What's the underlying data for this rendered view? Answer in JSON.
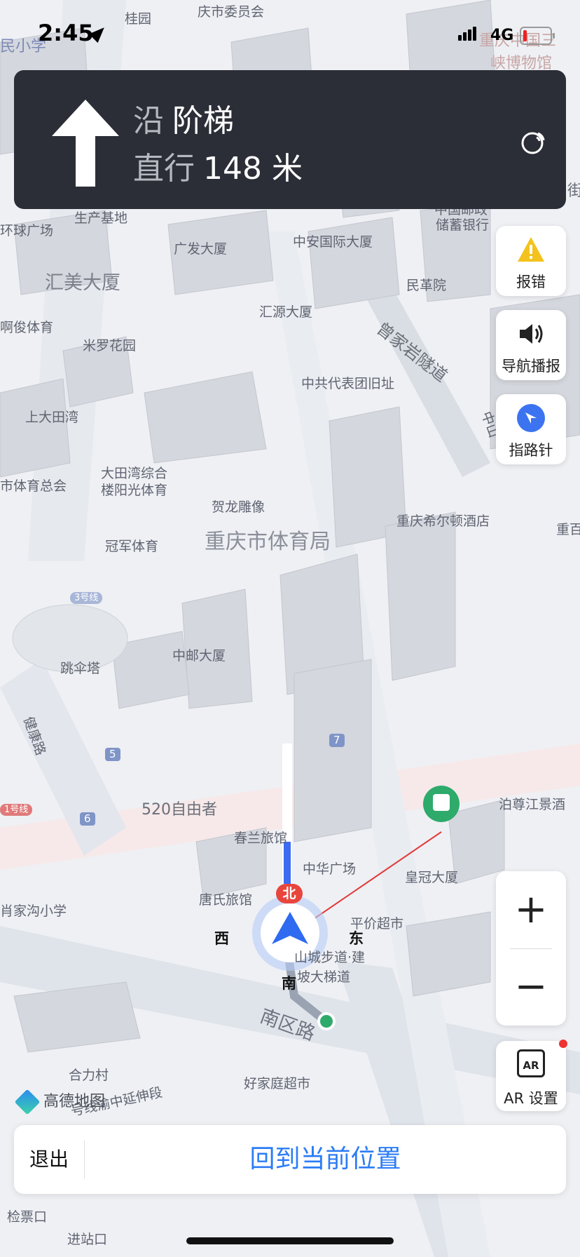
{
  "status_bar": {
    "time": "2:45",
    "network": "4G"
  },
  "navigation": {
    "along_prefix": "沿",
    "road": "阶梯",
    "action": "直行",
    "distance": "148 米"
  },
  "side_buttons": {
    "report": "报错",
    "voice": "导航播报",
    "compass": "指路针",
    "ar": "AR 设置",
    "ar_icon_text": "AR"
  },
  "zoom": {
    "plus": "+",
    "minus": "−"
  },
  "compass_labels": {
    "north": "北",
    "south": "南",
    "east": "东",
    "west": "西"
  },
  "brand": "高德地图",
  "bottom": {
    "exit": "退出",
    "return": "回到当前位置"
  },
  "map_labels": {
    "l1": "桂园",
    "l2": "庆市委员会",
    "l3": "民小学",
    "l4": "重庆中国三",
    "l5": "峡博物馆",
    "l6": "生产基地",
    "l7": "环球广场",
    "l8": "广发大厦",
    "l9": "中安国际大厦",
    "l10": "中国邮政",
    "l11": "储蓄银行",
    "l12": "汇美大厦",
    "l13": "汇源大厦",
    "l14": "民革院",
    "l15": "曾家岩隧道",
    "l16": "啊俊体育",
    "l17": "米罗花园",
    "l18": "中共代表团旧址",
    "l19": "上大田湾",
    "l20": "大田湾综合",
    "l21": "楼阳光体育",
    "l22": "贺龙雕像",
    "l23": "市体育总会",
    "l24": "重庆希尔顿酒店",
    "l25": "重庆市体育局",
    "l26": "冠军体育",
    "l27": "3号线",
    "l28": "跳伞塔",
    "l29": "中邮大厦",
    "l30": "健康路",
    "l31": "520自由者",
    "l32": "春兰旅馆",
    "l33": "中华广场",
    "l34": "皇冠大厦",
    "l35": "泊尊江景酒",
    "l36": "肖家沟小学",
    "l37": "唐氏旅馆",
    "l38": "平价超市",
    "l39": "山城步道·建",
    "l40": "坡大梯道",
    "l41": "南区路",
    "l42": "合力村",
    "l43": "号线渝中延伸段",
    "l44": "好家庭超市",
    "l45": "检票口",
    "l46": "进站口",
    "l47": "中山",
    "l48": "重百",
    "l49": "7",
    "l50": "5",
    "l51": "6",
    "l52": "1号线",
    "l53": "街"
  }
}
